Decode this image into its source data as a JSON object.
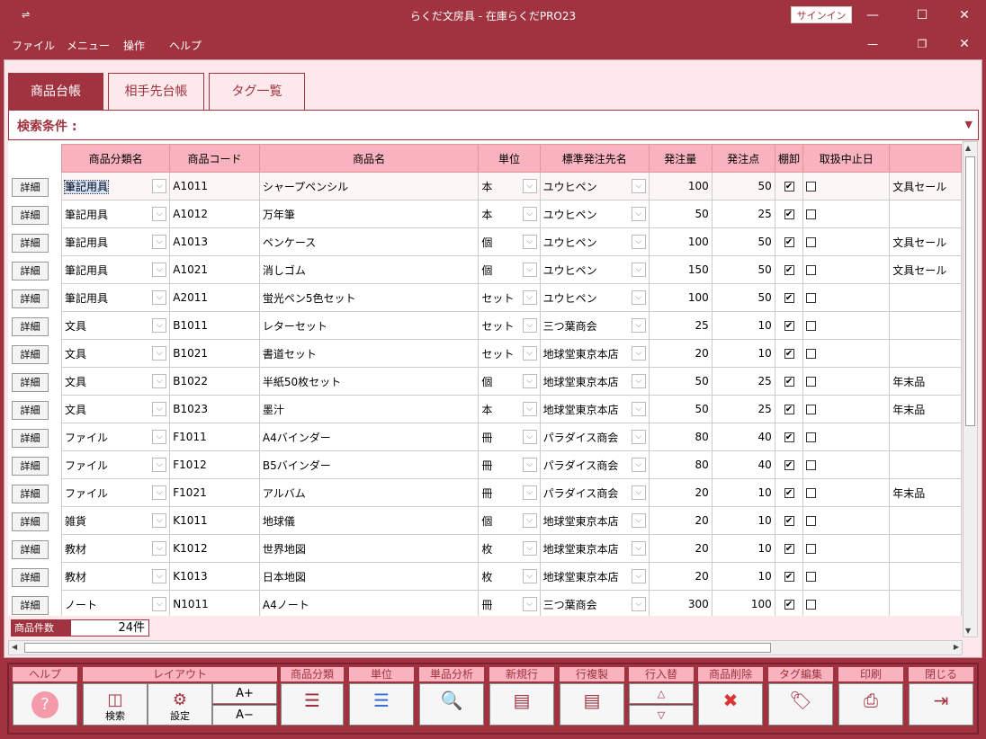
{
  "window": {
    "title": "らくだ文房具 - 在庫らくだPRO23",
    "signin_label": "サインイン",
    "sysmenu_glyph": "⇌"
  },
  "menu": [
    "ファイル",
    "メニュー",
    "操作",
    "ヘルプ"
  ],
  "tabs": [
    "商品台帳",
    "相手先台帳",
    "タグ一覧"
  ],
  "search": {
    "label": "検索条件 :"
  },
  "grid": {
    "detail_label": "詳細",
    "columns": [
      "商品分類名",
      "商品コード",
      "商品名",
      "単位",
      "標準発注先名",
      "発注量",
      "発注点",
      "棚卸",
      "取扱中止日",
      ""
    ],
    "rows": [
      [
        "筆記用具",
        "A1011",
        "シャープペンシル",
        "本",
        "ユウヒペン",
        "100",
        "50",
        true,
        false,
        "文具セール"
      ],
      [
        "筆記用具",
        "A1012",
        "万年筆",
        "本",
        "ユウヒペン",
        "50",
        "25",
        true,
        false,
        ""
      ],
      [
        "筆記用具",
        "A1013",
        "ペンケース",
        "個",
        "ユウヒペン",
        "100",
        "50",
        true,
        false,
        "文具セール"
      ],
      [
        "筆記用具",
        "A1021",
        "消しゴム",
        "個",
        "ユウヒペン",
        "150",
        "50",
        true,
        false,
        "文具セール"
      ],
      [
        "筆記用具",
        "A2011",
        "蛍光ペン5色セット",
        "セット",
        "ユウヒペン",
        "100",
        "50",
        true,
        false,
        ""
      ],
      [
        "文具",
        "B1011",
        "レターセット",
        "セット",
        "三つ葉商会",
        "25",
        "10",
        true,
        false,
        ""
      ],
      [
        "文具",
        "B1021",
        "書道セット",
        "セット",
        "地球堂東京本店",
        "20",
        "10",
        true,
        false,
        ""
      ],
      [
        "文具",
        "B1022",
        "半紙50枚セット",
        "個",
        "地球堂東京本店",
        "50",
        "25",
        true,
        false,
        "年末品"
      ],
      [
        "文具",
        "B1023",
        "墨汁",
        "本",
        "地球堂東京本店",
        "50",
        "25",
        true,
        false,
        "年末品"
      ],
      [
        "ファイル",
        "F1011",
        "A4バインダー",
        "冊",
        "パラダイス商会",
        "80",
        "40",
        true,
        false,
        ""
      ],
      [
        "ファイル",
        "F1012",
        "B5バインダー",
        "冊",
        "パラダイス商会",
        "80",
        "40",
        true,
        false,
        ""
      ],
      [
        "ファイル",
        "F1021",
        "アルバム",
        "冊",
        "パラダイス商会",
        "20",
        "10",
        true,
        false,
        "年末品"
      ],
      [
        "雑貨",
        "K1011",
        "地球儀",
        "個",
        "地球堂東京本店",
        "20",
        "10",
        true,
        false,
        ""
      ],
      [
        "教材",
        "K1012",
        "世界地図",
        "枚",
        "地球堂東京本店",
        "20",
        "10",
        true,
        false,
        ""
      ],
      [
        "教材",
        "K1013",
        "日本地図",
        "枚",
        "地球堂東京本店",
        "20",
        "10",
        true,
        false,
        ""
      ],
      [
        "ノート",
        "N1011",
        "A4ノート",
        "冊",
        "三つ葉商会",
        "300",
        "100",
        true,
        false,
        ""
      ]
    ]
  },
  "count": {
    "label": "商品件数",
    "value": "24件"
  },
  "toolbar": {
    "help": {
      "group": "ヘルプ"
    },
    "layout": {
      "group": "レイアウト",
      "search": "検索",
      "settings": "設定",
      "font_up": "A+",
      "font_down": "A−"
    },
    "category": {
      "group": "商品分類"
    },
    "unit": {
      "group": "単位"
    },
    "analysis": {
      "group": "単品分析"
    },
    "newrow": {
      "group": "新規行"
    },
    "duprow": {
      "group": "行複製"
    },
    "swaprow": {
      "group": "行入替"
    },
    "delete": {
      "group": "商品削除"
    },
    "tagedit": {
      "group": "タグ編集"
    },
    "print": {
      "group": "印刷"
    },
    "close": {
      "group": "閉じる"
    }
  }
}
